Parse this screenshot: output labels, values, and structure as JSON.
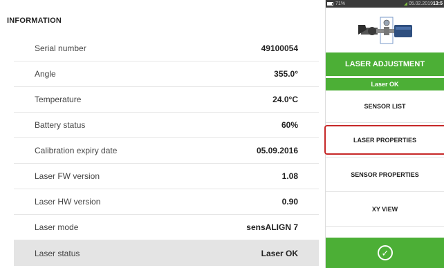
{
  "info": {
    "title": "INFORMATION",
    "rows": [
      {
        "label": "Serial number",
        "value": "49100054"
      },
      {
        "label": "Angle",
        "value": "355.0°"
      },
      {
        "label": "Temperature",
        "value": "24.0°C"
      },
      {
        "label": "Battery status",
        "value": "60%"
      },
      {
        "label": "Calibration expiry date",
        "value": "05.09.2016"
      },
      {
        "label": "Laser FW version",
        "value": "1.08"
      },
      {
        "label": "Laser HW version",
        "value": "0.90"
      },
      {
        "label": "Laser mode",
        "value": "sensALIGN 7"
      },
      {
        "label": "Laser status",
        "value": "Laser OK"
      }
    ]
  },
  "status_bar": {
    "battery": "71%",
    "date": "05.02.2019",
    "time": "13:5"
  },
  "sidebar": {
    "laser_adjustment": "LASER ADJUSTMENT",
    "laser_ok": "Laser OK",
    "items": [
      {
        "label": "SENSOR LIST"
      },
      {
        "label": "LASER PROPERTIES"
      },
      {
        "label": "SENSOR PROPERTIES"
      },
      {
        "label": "XY VIEW"
      }
    ],
    "confirm_icon": "check-circle-icon"
  },
  "colors": {
    "accent_green": "#4caf36",
    "active_red": "#e53935",
    "highlight_row": "#e4e4e4"
  }
}
